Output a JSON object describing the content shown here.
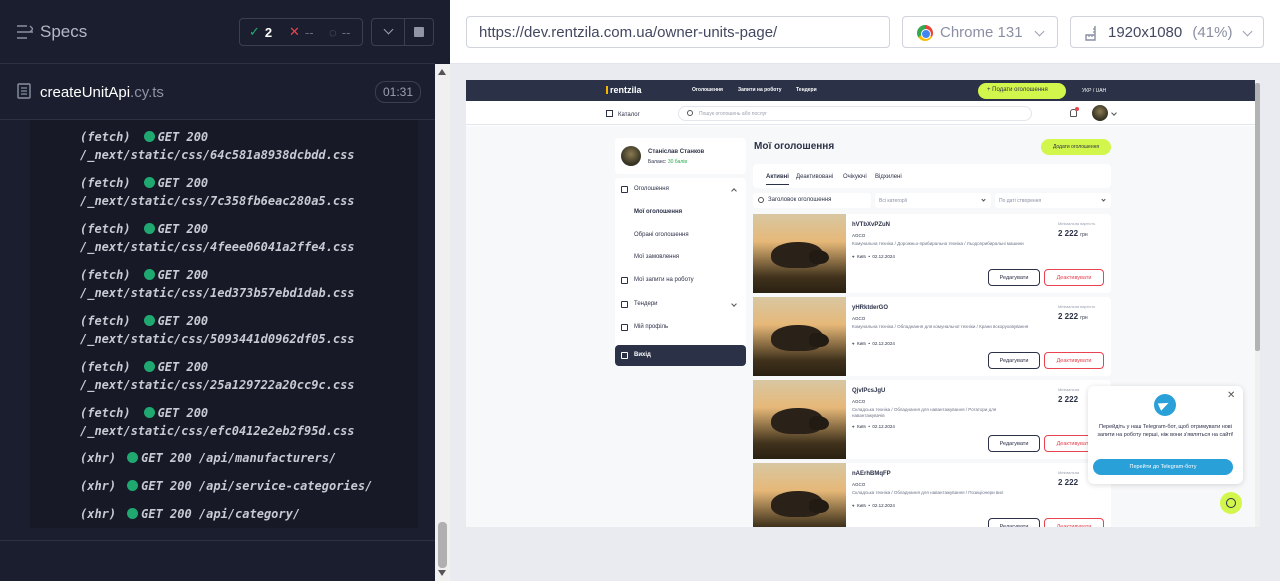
{
  "runner": {
    "title": "Specs",
    "stats": {
      "passed": "2",
      "failed": "--",
      "pending": "--"
    },
    "file": {
      "name": "createUnitApi",
      "ext": ".cy.ts",
      "duration": "01:31"
    },
    "log": [
      {
        "type": "(fetch)",
        "method": "GET 200",
        "url": "/_next/static/css/64c581a8938dcbdd.css"
      },
      {
        "type": "(fetch)",
        "method": "GET 200",
        "url": "/_next/static/css/7c358fb6eac280a5.css"
      },
      {
        "type": "(fetch)",
        "method": "GET 200",
        "url": "/_next/static/css/4feee06041a2ffe4.css"
      },
      {
        "type": "(fetch)",
        "method": "GET 200",
        "url": "/_next/static/css/1ed373b57ebd1dab.css"
      },
      {
        "type": "(fetch)",
        "method": "GET 200",
        "url": "/_next/static/css/5093441d0962df05.css"
      },
      {
        "type": "(fetch)",
        "method": "GET 200",
        "url": "/_next/static/css/25a129722a20cc9c.css"
      },
      {
        "type": "(fetch)",
        "method": "GET 200",
        "url": "/_next/static/css/efc0412e2eb2f95d.css"
      },
      {
        "type": "(xhr)",
        "method": "GET 200 /api/manufacturers/"
      },
      {
        "type": "(xhr)",
        "method": "GET 200 /api/service-categories/"
      },
      {
        "type": "(xhr)",
        "method": "GET 200 /api/category/"
      }
    ]
  },
  "toolbar": {
    "url": "https://dev.rentzila.com.ua/owner-units-page/",
    "browser": "Chrome 131",
    "viewport": "1920x1080",
    "zoom": "(41%)"
  },
  "site": {
    "logo": "rentzila",
    "nav": [
      "Оголошення",
      "Запити на роботу",
      "Тендери"
    ],
    "add_ad": "Подати оголошення",
    "lang": "УКР / UAH",
    "catalog": "Каталог",
    "search_placeholder": "Пошук оголошень або послуг",
    "profile": {
      "name": "Станіслав Станков",
      "balance_label": "Баланс:",
      "balance_value": "30 балів"
    },
    "menu": {
      "ads": "Оголошення",
      "my_ads": "Мої оголошення",
      "fav_ads": "Обрані оголошення",
      "orders": "Мої замовлення",
      "requests": "Мої запити на роботу",
      "tenders": "Тендери",
      "profile": "Мій профіль",
      "exit": "Вихід"
    },
    "page_title": "Мої оголошення",
    "add_btn": "Додати оголошення",
    "tabs": [
      "Активні",
      "Деактивовані",
      "Очікуючі",
      "Відхилені"
    ],
    "filters": {
      "search": "Заголовок оголошення",
      "category": "Всі категорії",
      "sort": "По даті створення"
    },
    "cards": [
      {
        "name": "hVTbXvPZuN",
        "brand": "AGCO",
        "category": "Комунальна техніка / Дорожньо-прибиральна техніка / Льодоприбиральні машини",
        "city": "Київ",
        "date": "02.12.2024",
        "price_label": "Мінімальна вартість",
        "price": "2 222",
        "currency": "грн"
      },
      {
        "name": "yHRktderGO",
        "brand": "AGCO",
        "category": "Комунальна техніка / Обладнання для комунальної техніки / Крани вскоруховування",
        "city": "Київ",
        "date": "02.12.2024",
        "price_label": "Мінімальна вартість",
        "price": "2 222",
        "currency": "грн"
      },
      {
        "name": "QjvlPcsJgU",
        "brand": "AGCO",
        "category": "Складська техніка / Обладнання для навантажування / Ротатори для навантажувачів",
        "city": "Київ",
        "date": "02.12.2024",
        "price_label": "Мінімальна",
        "price": "2 222",
        "currency": ""
      },
      {
        "name": "nAErhBMqFP",
        "brand": "AGCO",
        "category": "Складська техніка / Обладнання для навантажування / Позиціонери вил",
        "city": "Київ",
        "date": "02.12.2024",
        "price_label": "Мінімальна",
        "price": "2 222",
        "currency": ""
      }
    ],
    "card_buttons": {
      "edit": "Редагувати",
      "deactivate": "Деактивувати"
    },
    "popup": {
      "message": "Перейдіть у наш Telegram-бот, щоб отримувати нові запити на роботу перші, ніж вони з'являться на сайті!",
      "button": "Перейти до Telegram-боту"
    }
  }
}
